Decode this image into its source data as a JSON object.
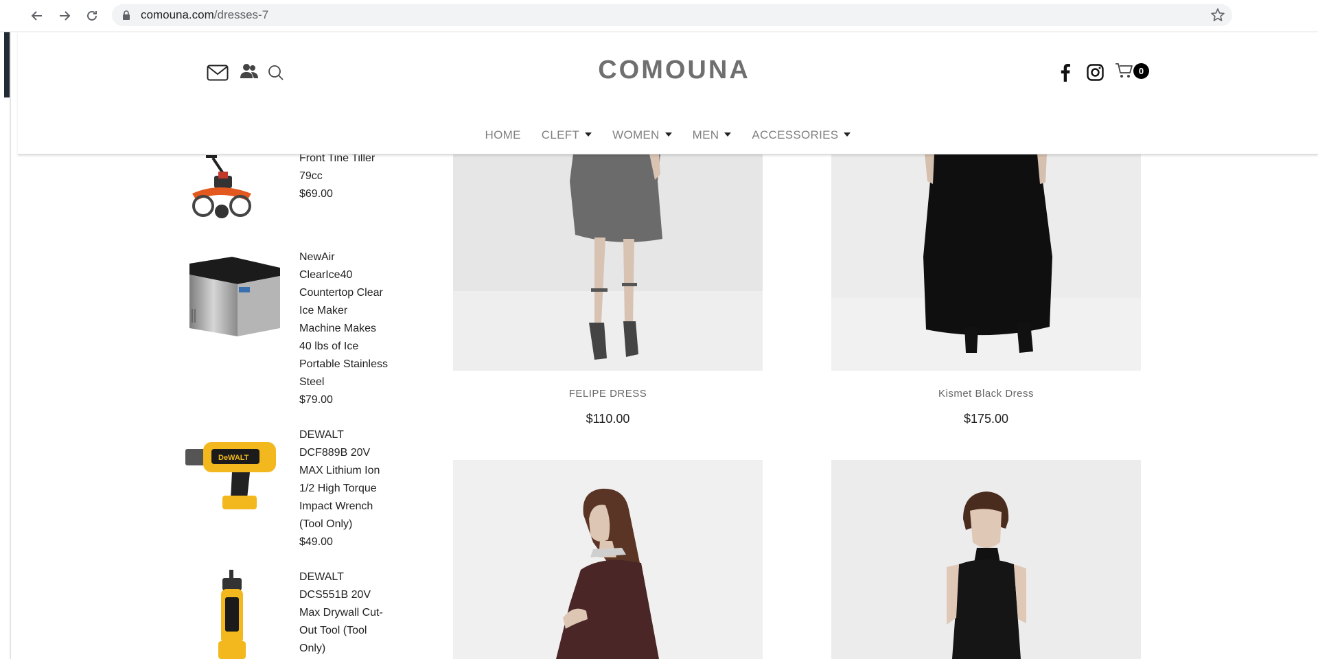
{
  "browser": {
    "url_host": "comouna.com",
    "url_path": "/dresses-7"
  },
  "header": {
    "brand": "COMOUNA",
    "cart_count": "0",
    "nav": [
      {
        "label": "HOME",
        "has_dropdown": false
      },
      {
        "label": "CLEFT",
        "has_dropdown": true
      },
      {
        "label": "WOMEN",
        "has_dropdown": true
      },
      {
        "label": "MEN",
        "has_dropdown": true
      },
      {
        "label": "ACCESSORIES",
        "has_dropdown": true
      }
    ]
  },
  "sidebar": {
    "items": [
      {
        "name": "Front Tine Tiller\n79cc",
        "price": "$69.00"
      },
      {
        "name": "NewAir\nClearIce40\nCountertop Clear\nIce Maker\nMachine Makes\n40 lbs of Ice\nPortable Stainless\nSteel",
        "price": "$79.00"
      },
      {
        "name": "DEWALT\nDCF889B 20V\nMAX Lithium Ion\n1/2 High Torque\nImpact Wrench\n(Tool Only)",
        "price": "$49.00"
      },
      {
        "name": "DEWALT\nDCS551B 20V\nMax Drywall Cut-\nOut Tool (Tool\nOnly)",
        "price": ""
      }
    ]
  },
  "products": [
    {
      "name": "FELIPE DRESS",
      "price": "$110.00"
    },
    {
      "name": "Kismet Black Dress",
      "price": "$175.00"
    },
    {
      "name": "",
      "price": ""
    },
    {
      "name": "",
      "price": ""
    }
  ]
}
